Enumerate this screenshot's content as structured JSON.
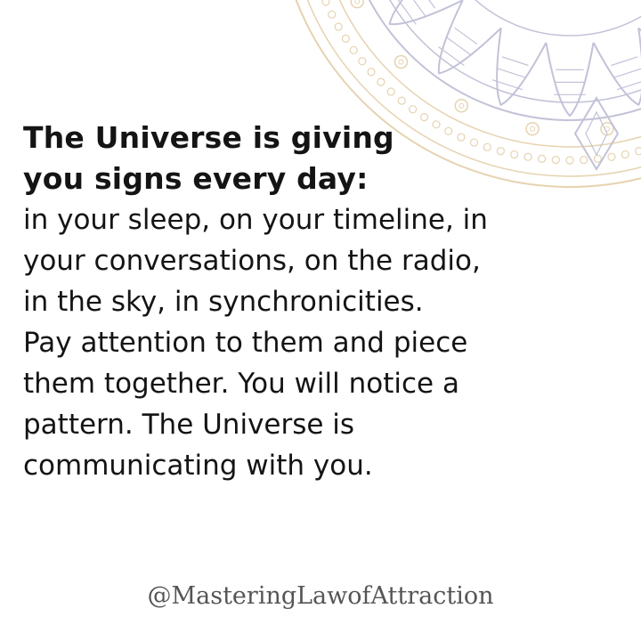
{
  "quote": {
    "headline_lines": [
      "The Universe is giving",
      "you signs every day:"
    ],
    "body_lines": [
      "in your sleep, on your timeline, in",
      "your conversations, on the radio,",
      "in the sky, in synchronicities.",
      "Pay attention to them and piece",
      "them together. You will notice a",
      "pattern. The Universe is",
      "communicating with you."
    ]
  },
  "footer": {
    "handle": "@MasteringLawofAttraction"
  },
  "colors": {
    "background": "#ffffff",
    "text": "#141414",
    "handle": "#555555",
    "mandala_gold": "#e6d3b0",
    "mandala_violet": "#c2c2d8",
    "mandala_pink": "#e8b8aa"
  },
  "decoration": {
    "icon": "mandala-ornament"
  }
}
